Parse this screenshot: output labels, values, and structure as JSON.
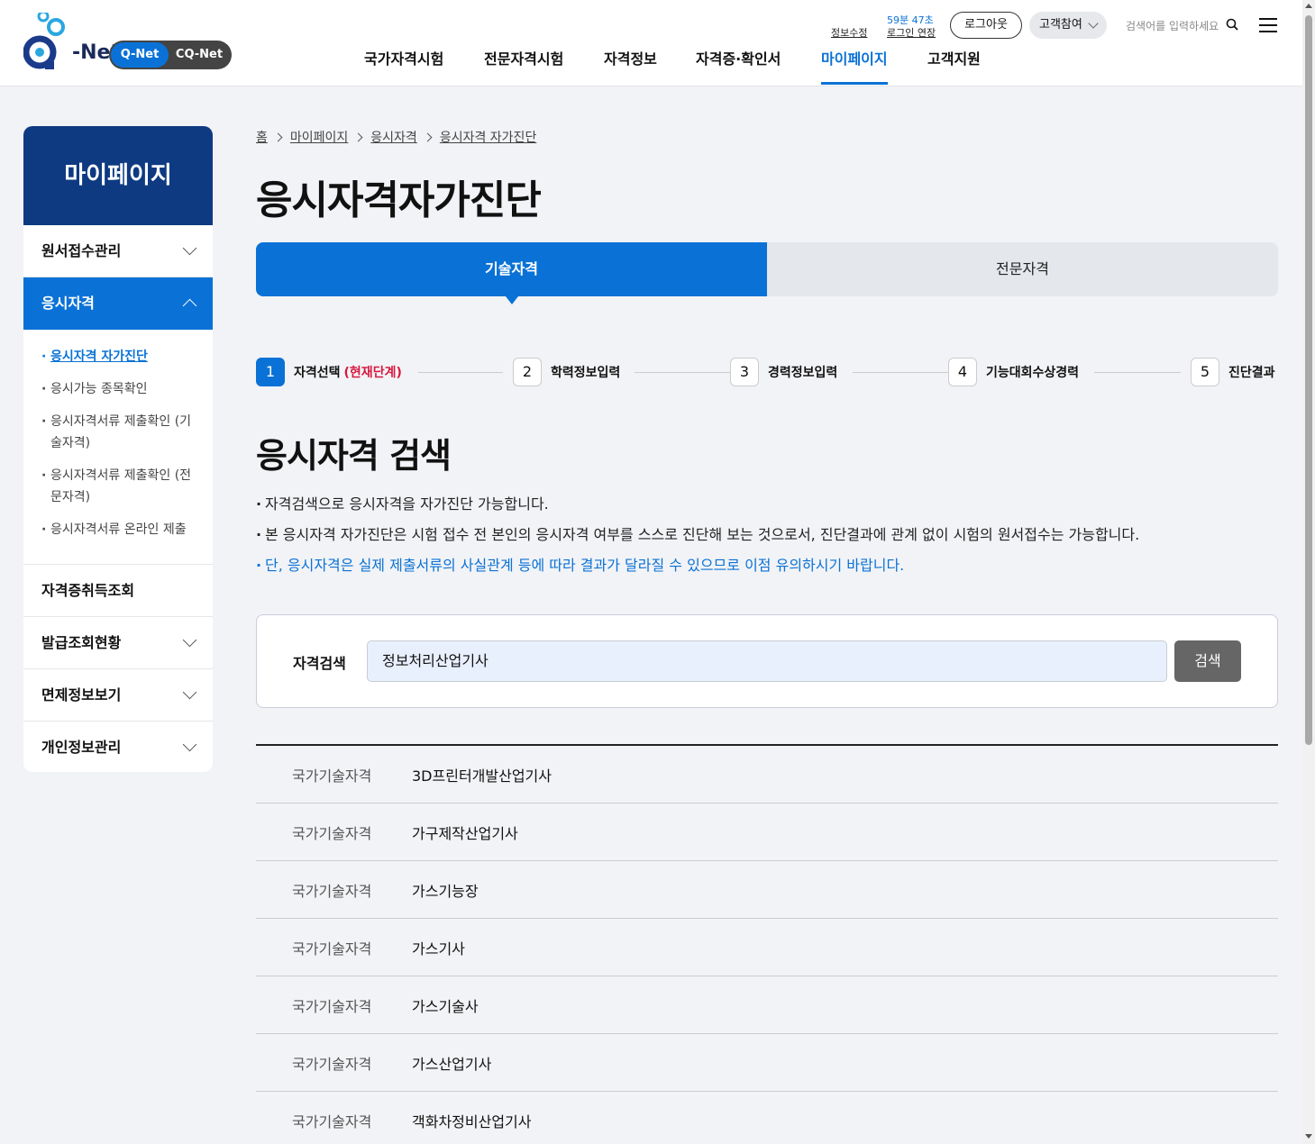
{
  "header": {
    "logo_text": "-Net",
    "net_switch": {
      "qnet": "Q-Net",
      "cqnet": "CQ-Net"
    },
    "util": {
      "edit_info": "정보수정",
      "timer": "59분 47초",
      "extend_login": "로그인 연장",
      "logout": "로그아웃",
      "customer": "고객참여",
      "search_placeholder": "검색어를 입력하세요"
    },
    "gnb": [
      {
        "label": "국가자격시험"
      },
      {
        "label": "전문자격시험"
      },
      {
        "label": "자격정보"
      },
      {
        "label": "자격증·확인서"
      },
      {
        "label": "마이페이지"
      },
      {
        "label": "고객지원"
      }
    ]
  },
  "sidebar": {
    "title": "마이페이지",
    "items": [
      {
        "label": "원서접수관리"
      },
      {
        "label": "응시자격"
      },
      {
        "label": "자격증취득조회"
      },
      {
        "label": "발급조회현황"
      },
      {
        "label": "면제정보보기"
      },
      {
        "label": "개인정보관리"
      }
    ],
    "sub_items": [
      {
        "label": "응시자격 자가진단"
      },
      {
        "label": "응시가능 종목확인"
      },
      {
        "label": "응시자격서류 제출확인 (기술자격)"
      },
      {
        "label": "응시자격서류 제출확인 (전문자격)"
      },
      {
        "label": "응시자격서류 온라인 제출"
      }
    ]
  },
  "breadcrumb": [
    "홈",
    "마이페이지",
    "응시자격",
    "응시자격 자가진단"
  ],
  "page_title": "응시자격자가진단",
  "tabs": [
    {
      "label": "기술자격",
      "active": true
    },
    {
      "label": "전문자격",
      "active": false
    }
  ],
  "steps": [
    {
      "num": "1",
      "label": "자격선택",
      "current": "(현재단계)"
    },
    {
      "num": "2",
      "label": "학력정보입력"
    },
    {
      "num": "3",
      "label": "경력정보입력"
    },
    {
      "num": "4",
      "label": "기능대회수상경력"
    },
    {
      "num": "5",
      "label": "진단결과"
    }
  ],
  "section_title": "응시자격 검색",
  "notes": [
    "자격검색으로 응시자격을 자가진단 가능합니다.",
    "본 응시자격 자가진단은 시험 접수 전 본인의 응시자격 여부를 스스로 진단해 보는 것으로서, 진단결과에 관계 없이 시험의 원서접수는 가능합니다.",
    "단, 응시자격은 실제 제출서류의 사실관계 등에 따라 결과가 달라질 수 있으므로 이점 유의하시기 바랍니다."
  ],
  "search": {
    "label": "자격검색",
    "value": "정보처리산업기사",
    "button": "검색"
  },
  "results": [
    {
      "category": "국가기술자격",
      "name": "3D프린터개발산업기사"
    },
    {
      "category": "국가기술자격",
      "name": "가구제작산업기사"
    },
    {
      "category": "국가기술자격",
      "name": "가스기능장"
    },
    {
      "category": "국가기술자격",
      "name": "가스기사"
    },
    {
      "category": "국가기술자격",
      "name": "가스기술사"
    },
    {
      "category": "국가기술자격",
      "name": "가스산업기사"
    },
    {
      "category": "국가기술자격",
      "name": "객화차정비산업기사"
    }
  ],
  "colors": {
    "brand_blue": "#0a72d6",
    "sidebar_title": "#0e3a82",
    "current_step_red": "#d6193f"
  }
}
